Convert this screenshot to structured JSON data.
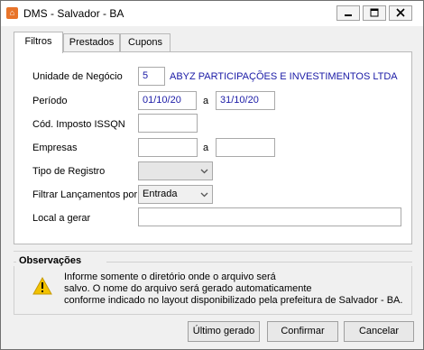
{
  "window": {
    "title": "DMS - Salvador - BA"
  },
  "tabs": [
    {
      "label": "Filtros",
      "active": true
    },
    {
      "label": "Prestados",
      "active": false
    },
    {
      "label": "Cupons",
      "active": false
    }
  ],
  "form": {
    "unidade_label": "Unidade de Negócio",
    "unidade_code": "5",
    "unidade_name": "ABYZ PARTICIPAÇÕES E INVESTIMENTOS LTDA",
    "periodo_label": "Período",
    "periodo_start": "01/10/20",
    "periodo_sep": "a",
    "periodo_end": "31/10/20",
    "cod_label": "Cód. Imposto ISSQN",
    "cod_value": "",
    "empresas_label": "Empresas",
    "empresas_start": "",
    "empresas_sep": "a",
    "empresas_end": "",
    "tipo_label": "Tipo de Registro",
    "tipo_value": "",
    "filtrar_label": "Filtrar Lançamentos por",
    "filtrar_value": "Entrada",
    "local_label": "Local a gerar",
    "local_value": ""
  },
  "observacoes": {
    "title": "Observações",
    "line1": "Informe somente o diretório onde o arquivo será",
    "line2": "salvo. O nome do arquivo será gerado automaticamente",
    "line3": "conforme indicado no layout disponibilizado pela prefeitura de Salvador - BA."
  },
  "buttons": {
    "ultimo": "Último gerado",
    "confirmar": "Confirmar",
    "cancelar": "Cancelar"
  },
  "colors": {
    "accent_text": "#1a1aa6",
    "warning": "#f2c200"
  }
}
